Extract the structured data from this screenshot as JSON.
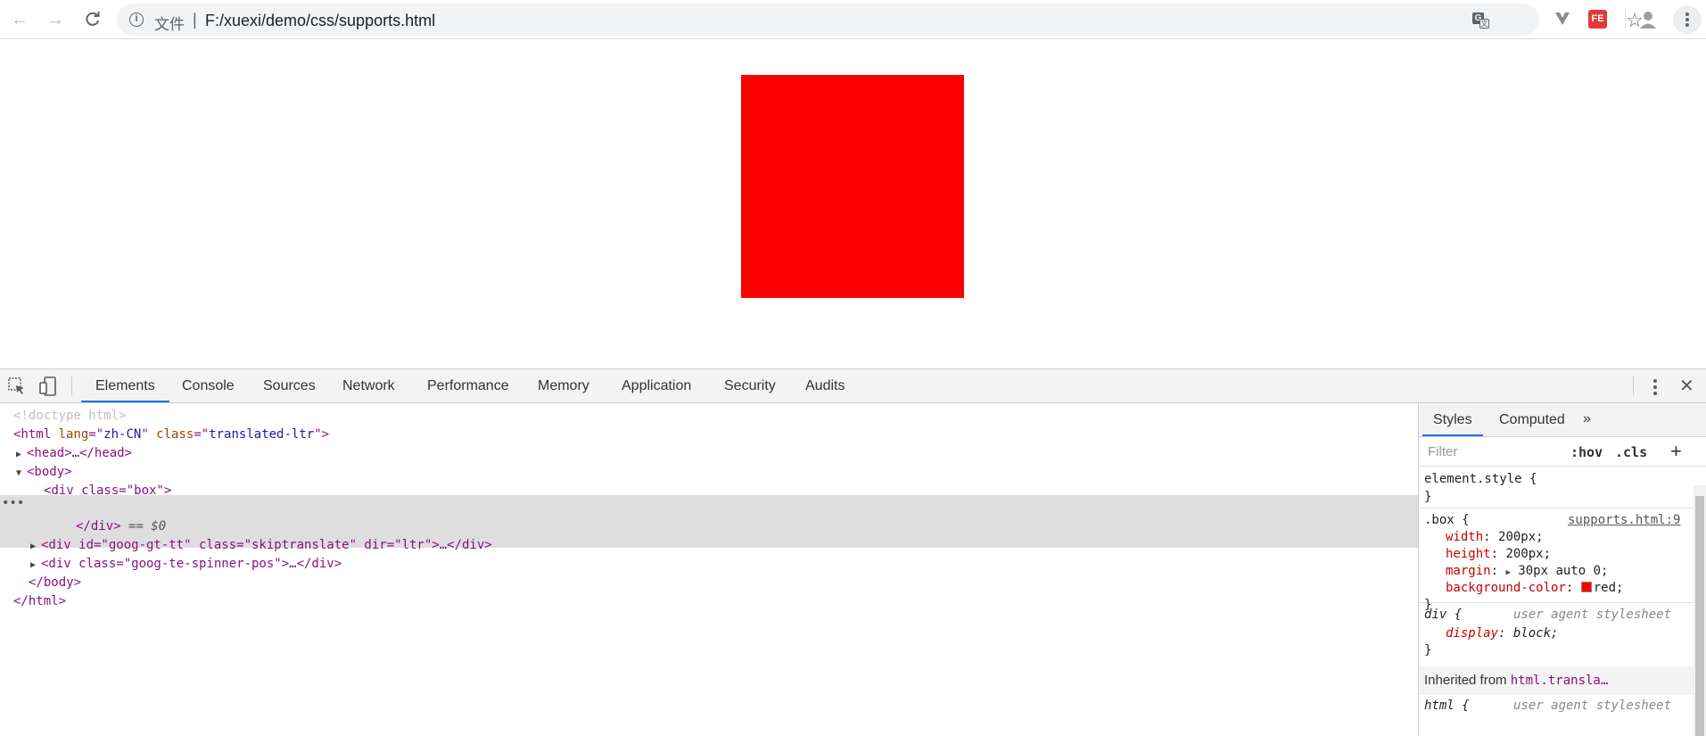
{
  "browser": {
    "url_scheme_label": "文件",
    "url": "F:/xuexi/demo/css/supports.html",
    "ext_fe_label": "FE"
  },
  "devtools": {
    "tabs": [
      "Elements",
      "Console",
      "Sources",
      "Network",
      "Performance",
      "Memory",
      "Application",
      "Security",
      "Audits"
    ],
    "active_tab": "Elements",
    "dom": {
      "doctype": "<!doctype html>",
      "html_open": {
        "tag": "html",
        "attrs": [
          [
            "lang",
            "zh-CN"
          ],
          [
            "class",
            "translated-ltr"
          ]
        ]
      },
      "head": "<head>…</head>",
      "body_open": "<body>",
      "div_box_open": "<div class=\"box\">",
      "div_box_close": "</div>",
      "selected_marker": "== $0",
      "div_gt_tt": "<div id=\"goog-gt-tt\" class=\"skiptranslate\" dir=\"ltr\">…</div>",
      "div_spinner": "<div class=\"goog-te-spinner-pos\">…</div>",
      "body_close": "</body>",
      "html_close": "</html>",
      "ellipsis": "…"
    },
    "styles": {
      "tabs": [
        "Styles",
        "Computed"
      ],
      "more": "»",
      "filter_placeholder": "Filter",
      "hov": ":hov",
      "cls": ".cls",
      "add": "+",
      "element_style": {
        "selector": "element.style {",
        "close": "}"
      },
      "box_rule": {
        "selector": ".box {",
        "source": "supports.html:9",
        "declarations": [
          {
            "prop": "width",
            "value": "200px;"
          },
          {
            "prop": "height",
            "value": "200px;"
          },
          {
            "prop": "margin",
            "value": "30px auto 0;"
          },
          {
            "prop": "background-color",
            "value": "red;"
          }
        ],
        "close": "}"
      },
      "div_rule": {
        "selector": "div {",
        "source": "user agent stylesheet",
        "declarations": [
          {
            "prop": "display",
            "value": "block;"
          }
        ],
        "close": "}"
      },
      "inherited_label": "Inherited from",
      "inherited_selector": "html.transla…",
      "html_rule": {
        "selector": "html {",
        "source": "user agent stylesheet"
      }
    }
  },
  "colors": {
    "box": "#ff0000",
    "accent": "#1a73e8"
  }
}
